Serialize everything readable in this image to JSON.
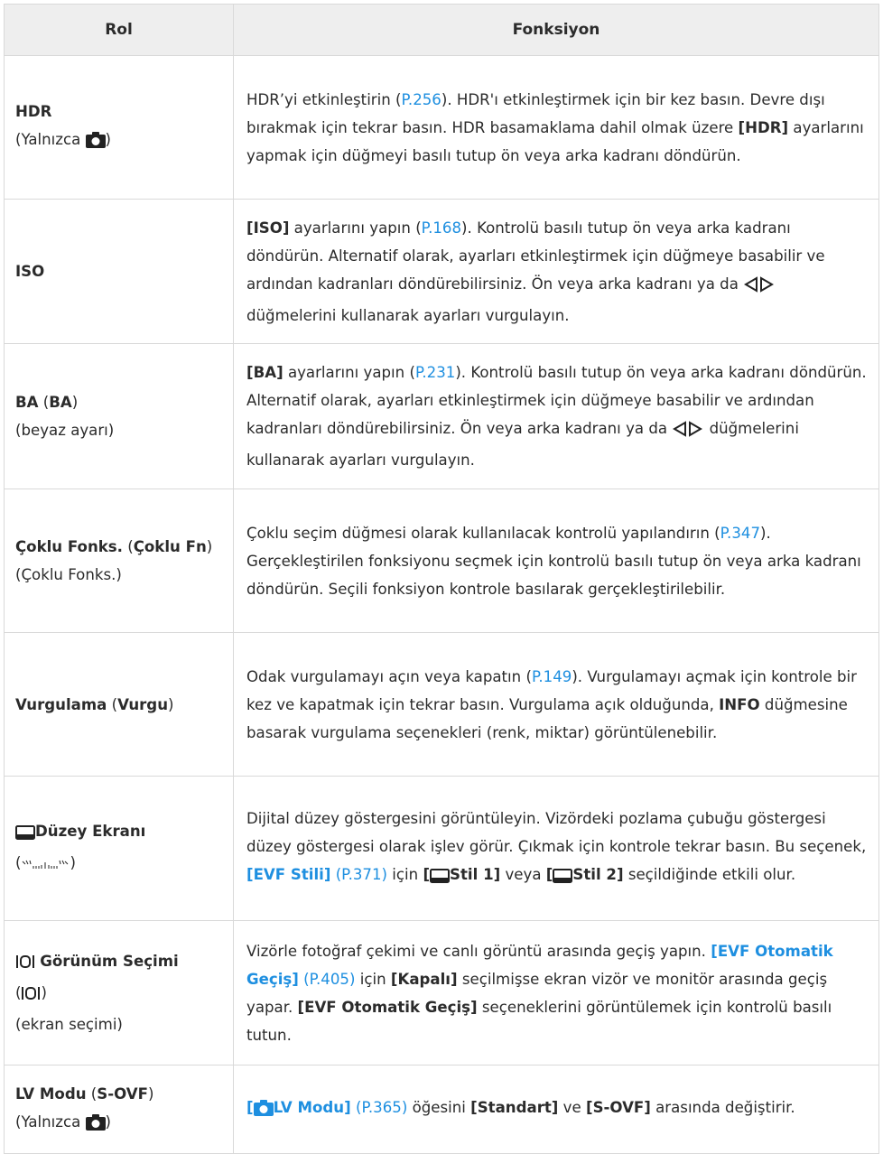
{
  "header": {
    "col_role": "Rol",
    "col_function": "Fonksiyon"
  },
  "rows": [
    {
      "role": {
        "name": "HDR",
        "sub": "(Yalnızca ",
        "sub_end": ")"
      },
      "func": {
        "p1": "HDR’yi etkinleştirin (",
        "link": "P.256",
        "p2": "). HDR'ı etkinleştirmek için bir kez basın. Devre dışı bırakmak için tekrar basın. HDR basamaklama dahil olmak üzere ",
        "b1": "[HDR]",
        "p3": " ayarlarını yapmak için düğmeyi basılı tutup ön veya arka kadranı döndürün."
      }
    },
    {
      "role": {
        "name": "ISO"
      },
      "func": {
        "b1": "[ISO]",
        "p1": " ayarlarını yapın (",
        "link": "P.168",
        "p2": "). Kontrolü basılı tutup ön veya arka kadranı döndürün. Alternatif olarak, ayarları etkinleştirmek için düğmeye basabilir ve ardından kadranları döndürebilirsiniz. Ön veya arka kadranı ya da ",
        "p3": " düğmelerini kullanarak ayarları vurgulayın."
      }
    },
    {
      "role": {
        "name": "BA",
        "open": " (",
        "abbr": "BA",
        "close": ")",
        "sub": "(beyaz ayarı)"
      },
      "func": {
        "b1": "[BA]",
        "p1": " ayarlarını yapın (",
        "link": "P.231",
        "p2": "). Kontrolü basılı tutup ön veya arka kadranı döndürün. Alternatif olarak, ayarları etkinleştirmek için düğmeye basabilir ve ardından kadranları döndürebilirsiniz. Ön veya arka kadranı ya da ",
        "p3": " düğmelerini kullanarak ayarları vurgulayın."
      }
    },
    {
      "role": {
        "name": "Çoklu Fonks.",
        "open": " (",
        "abbr": "Çoklu Fn",
        "close": ")",
        "sub": "(Çoklu Fonks.)"
      },
      "func": {
        "p1": "Çoklu seçim düğmesi olarak kullanılacak kontrolü yapılandırın (",
        "link": "P.347",
        "p2": "). Gerçekleştirilen fonksiyonu seçmek için kontrolü basılı tutup ön veya arka kadranı döndürün. Seçili fonksiyon kontrole basılarak gerçekleştirilebilir."
      }
    },
    {
      "role": {
        "name": "Vurgulama",
        "open": " (",
        "abbr": "Vurgu",
        "close": ")"
      },
      "func": {
        "p1": "Odak vurgulamayı açın veya kapatın (",
        "link": "P.149",
        "p2": "). Vurgulamayı açmak için kontrole bir kez ve kapatmak için tekrar basın. Vurgulama açık olduğunda, ",
        "b1": "INFO",
        "p3": " düğmesine basarak vurgulama seçenekleri (renk, miktar) görüntülenebilir."
      }
    },
    {
      "role": {
        "name": "Düzey Ekranı",
        "sub_open": "(",
        "sub_close": ")"
      },
      "func": {
        "p1": "Dijital düzey göstergesini görüntüleyin. Vizördeki pozlama çubuğu göstergesi düzey göstergesi olarak işlev görür. Çıkmak için kontrole tekrar basın. Bu seçenek, ",
        "lb1": "[EVF Stili]",
        "link": "(P.371)",
        "p2": " için ",
        "b1": "[",
        "b1b": "Stil 1]",
        "p3": " veya ",
        "b2": "[",
        "b2b": "Stil 2]",
        "p4": " seçildiğinde etkili olur."
      }
    },
    {
      "role": {
        "name": "Görünüm Seçimi",
        "sub_open": "(",
        "sub_close": ")",
        "sub2": "(ekran seçimi)"
      },
      "func": {
        "p1": "Vizörle fotoğraf çekimi ve canlı görüntü arasında geçiş yapın. ",
        "lb1": "[EVF Otomatik Geçiş]",
        "link": "(P.405)",
        "p2": " için ",
        "b1": "[Kapalı]",
        "p3": " seçilmişse ekran vizör ve monitör arasında geçiş yapar. ",
        "b2": "[EVF Otomatik Geçiş]",
        "p4": " seçeneklerini görüntülemek için kontrolü basılı tutun."
      }
    },
    {
      "role": {
        "name": "LV Modu",
        "open": " (",
        "abbr": "S-OVF",
        "close": ")",
        "sub": "(Yalnızca ",
        "sub_end": ")"
      },
      "func": {
        "lb1": "[",
        "lb1b": "LV Modu]",
        "link": "(P.365)",
        "p1": " öğesini ",
        "b1": "[Standart]",
        "p2": " ve ",
        "b2": "[S-OVF]",
        "p3": " arasında değiştirir."
      }
    }
  ]
}
